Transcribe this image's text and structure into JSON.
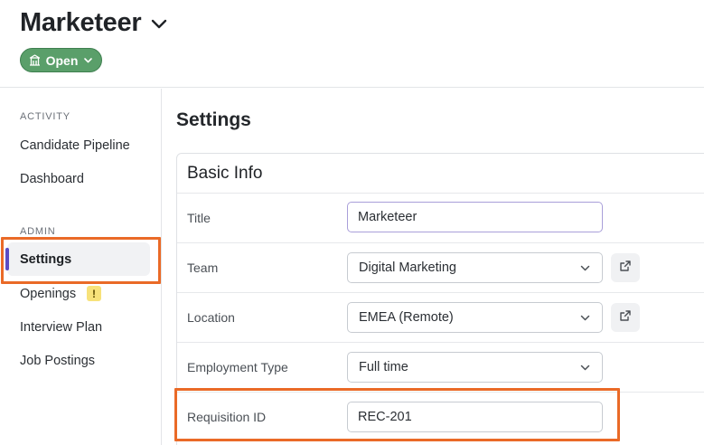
{
  "header": {
    "job_title": "Marketeer",
    "status_label": "Open"
  },
  "sidebar": {
    "sections": [
      {
        "label": "ACTIVITY",
        "items": [
          "Candidate Pipeline",
          "Dashboard"
        ]
      },
      {
        "label": "ADMIN",
        "items": [
          "Settings",
          "Openings",
          "Interview Plan",
          "Job Postings"
        ]
      }
    ],
    "active_item": "Settings",
    "openings_badge": "!"
  },
  "main": {
    "title": "Settings",
    "card": {
      "title": "Basic Info",
      "fields": [
        {
          "label": "Title",
          "type": "input",
          "value": "Marketeer"
        },
        {
          "label": "Team",
          "type": "select",
          "value": "Digital Marketing",
          "external_link_icon": "external-link-icon"
        },
        {
          "label": "Location",
          "type": "select",
          "value": "EMEA (Remote)",
          "external_link_icon": "external-link-icon"
        },
        {
          "label": "Employment Type",
          "type": "select",
          "value": "Full time"
        },
        {
          "label": "Requisition ID",
          "type": "input",
          "value": "REC-201"
        }
      ]
    }
  },
  "colors": {
    "accent": "#5b4cc4",
    "status_green": "#5a9f6a",
    "highlight_orange": "#ea6a27",
    "warning_badge": "#f7e27a"
  },
  "icons": [
    "chevron-down-icon",
    "building-icon",
    "external-link-icon",
    "warning-icon"
  ]
}
